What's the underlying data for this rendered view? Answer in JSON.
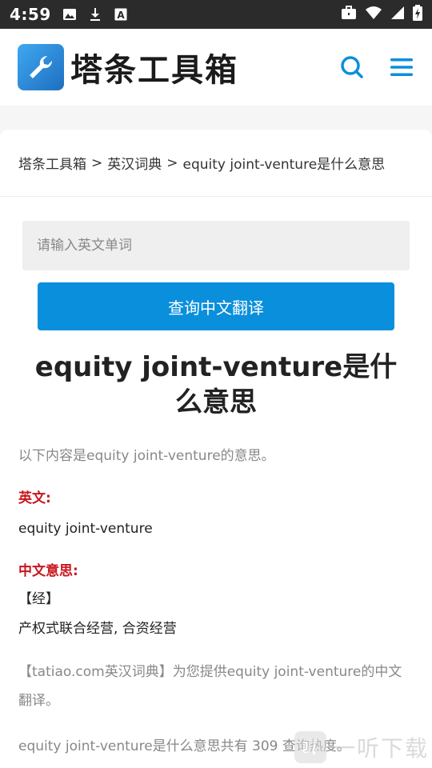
{
  "status_bar": {
    "time": "4:59",
    "left_icons": [
      "image-icon",
      "download-icon",
      "text-a-icon"
    ],
    "right_icons": [
      "briefcase-icon",
      "wifi-icon",
      "signal-icon",
      "battery-icon"
    ]
  },
  "header": {
    "logo_text": "塔条工具箱",
    "search_icon": "search-icon",
    "menu_icon": "menu-icon",
    "accent": "#0a8fdc"
  },
  "breadcrumb": {
    "items": [
      "塔条工具箱",
      "英汉词典",
      "equity joint-venture是什么意思"
    ],
    "separator": ">"
  },
  "search": {
    "placeholder": "请输入英文单词",
    "button_label": "查询中文翻译"
  },
  "article": {
    "title": "equity joint-venture是什么意思",
    "intro": "以下内容是equity joint-venture的意思。",
    "english_label": "英文:",
    "english_word": "equity joint-venture",
    "chinese_label": "中文意思:",
    "tag": "【经】",
    "meaning": "产权式联合经营, 合资经营",
    "note": "【tatiao.com英汉词典】为您提供equity joint-venture的中文翻译。",
    "stats": "equity joint-venture是什么意思共有 309 查询热度。",
    "label_color": "#c8161e"
  },
  "watermark": {
    "text": "一听下载"
  }
}
